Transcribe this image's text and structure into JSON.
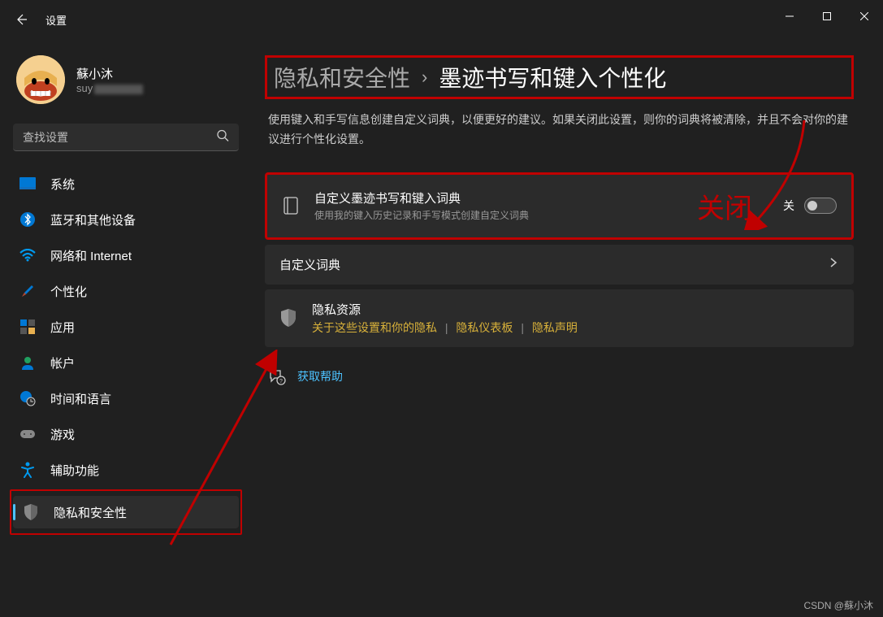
{
  "app": {
    "title": "设置"
  },
  "profile": {
    "name": "蘇小沐",
    "email_prefix": "suy"
  },
  "search": {
    "placeholder": "查找设置"
  },
  "sidebar": {
    "items": [
      {
        "label": "系统"
      },
      {
        "label": "蓝牙和其他设备"
      },
      {
        "label": "网络和 Internet"
      },
      {
        "label": "个性化"
      },
      {
        "label": "应用"
      },
      {
        "label": "帐户"
      },
      {
        "label": "时间和语言"
      },
      {
        "label": "游戏"
      },
      {
        "label": "辅助功能"
      },
      {
        "label": "隐私和安全性"
      }
    ]
  },
  "breadcrumb": {
    "parent": "隐私和安全性",
    "sep": "›",
    "current": "墨迹书写和键入个性化"
  },
  "description": "使用键入和手写信息创建自定义词典，以便更好的建议。如果关闭此设置，则你的词典将被清除，并且不会对你的建议进行个性化设置。",
  "card1": {
    "title": "自定义墨迹书写和键入词典",
    "sub": "使用我的键入历史记录和手写模式创建自定义词典",
    "toggle_label": "关"
  },
  "card2": {
    "title": "自定义词典"
  },
  "resources": {
    "title": "隐私资源",
    "link1": "关于这些设置和你的隐私",
    "link2": "隐私仪表板",
    "link3": "隐私声明"
  },
  "help": {
    "label": "获取帮助"
  },
  "annotation": {
    "close_label": "关闭"
  },
  "watermark": "CSDN @蘇小沐"
}
